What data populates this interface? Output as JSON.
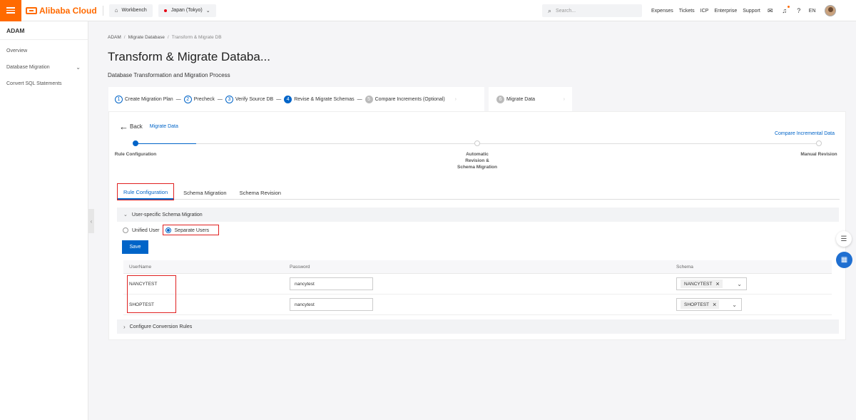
{
  "topbar": {
    "brand": "Alibaba Cloud",
    "workbench": "Workbench",
    "region": "Japan (Tokyo)",
    "search_placeholder": "Search...",
    "links": [
      "Expenses",
      "Tickets",
      "ICP",
      "Enterprise",
      "Support"
    ],
    "language": "EN"
  },
  "sidebar": {
    "title": "ADAM",
    "items": [
      {
        "label": "Overview"
      },
      {
        "label": "Database Migration"
      },
      {
        "label": "Convert SQL Statements"
      }
    ]
  },
  "breadcrumb": [
    "ADAM",
    "Migrate Database",
    "Transform & Migrate DB"
  ],
  "page": {
    "title": "Transform & Migrate Databa...",
    "subtitle": "Database Transformation and Migration Process"
  },
  "steps": [
    {
      "num": "1",
      "label": "Create Migration Plan"
    },
    {
      "num": "2",
      "label": "Precheck"
    },
    {
      "num": "3",
      "label": "Verify Source DB"
    },
    {
      "num": "4",
      "label": "Revise & Migrate Schemas"
    },
    {
      "num": "5",
      "label": "Compare Increments (Optional)"
    },
    {
      "num": "6",
      "label": "Migrate Data"
    }
  ],
  "card": {
    "back_label": "Back",
    "back_link": "Migrate Data",
    "compare_link": "Compare Incremental Data",
    "progress": {
      "node1": "Rule Configuration",
      "node2": "Automatic Revision & Schema Migration",
      "node3": "Manual Revision"
    },
    "tabs": [
      "Rule Configuration",
      "Schema Migration",
      "Schema Revision"
    ],
    "section_title": "User-specific Schema Migration",
    "radio": {
      "unified": "Unified User",
      "separate": "Separate Users"
    },
    "save_label": "Save",
    "table": {
      "headers": [
        "UserName",
        "Password",
        "Schema"
      ],
      "rows": [
        {
          "username": "NANCYTEST",
          "password": "nancytest",
          "schema": "NANCYTEST"
        },
        {
          "username": "SHOPTEST",
          "password": "nancytest",
          "schema": "SHOPTEST"
        }
      ]
    },
    "config_title": "Configure Conversion Rules"
  },
  "colors": {
    "accent": "#0064c8",
    "brand": "#ff6a00",
    "highlight": "#e02020"
  }
}
